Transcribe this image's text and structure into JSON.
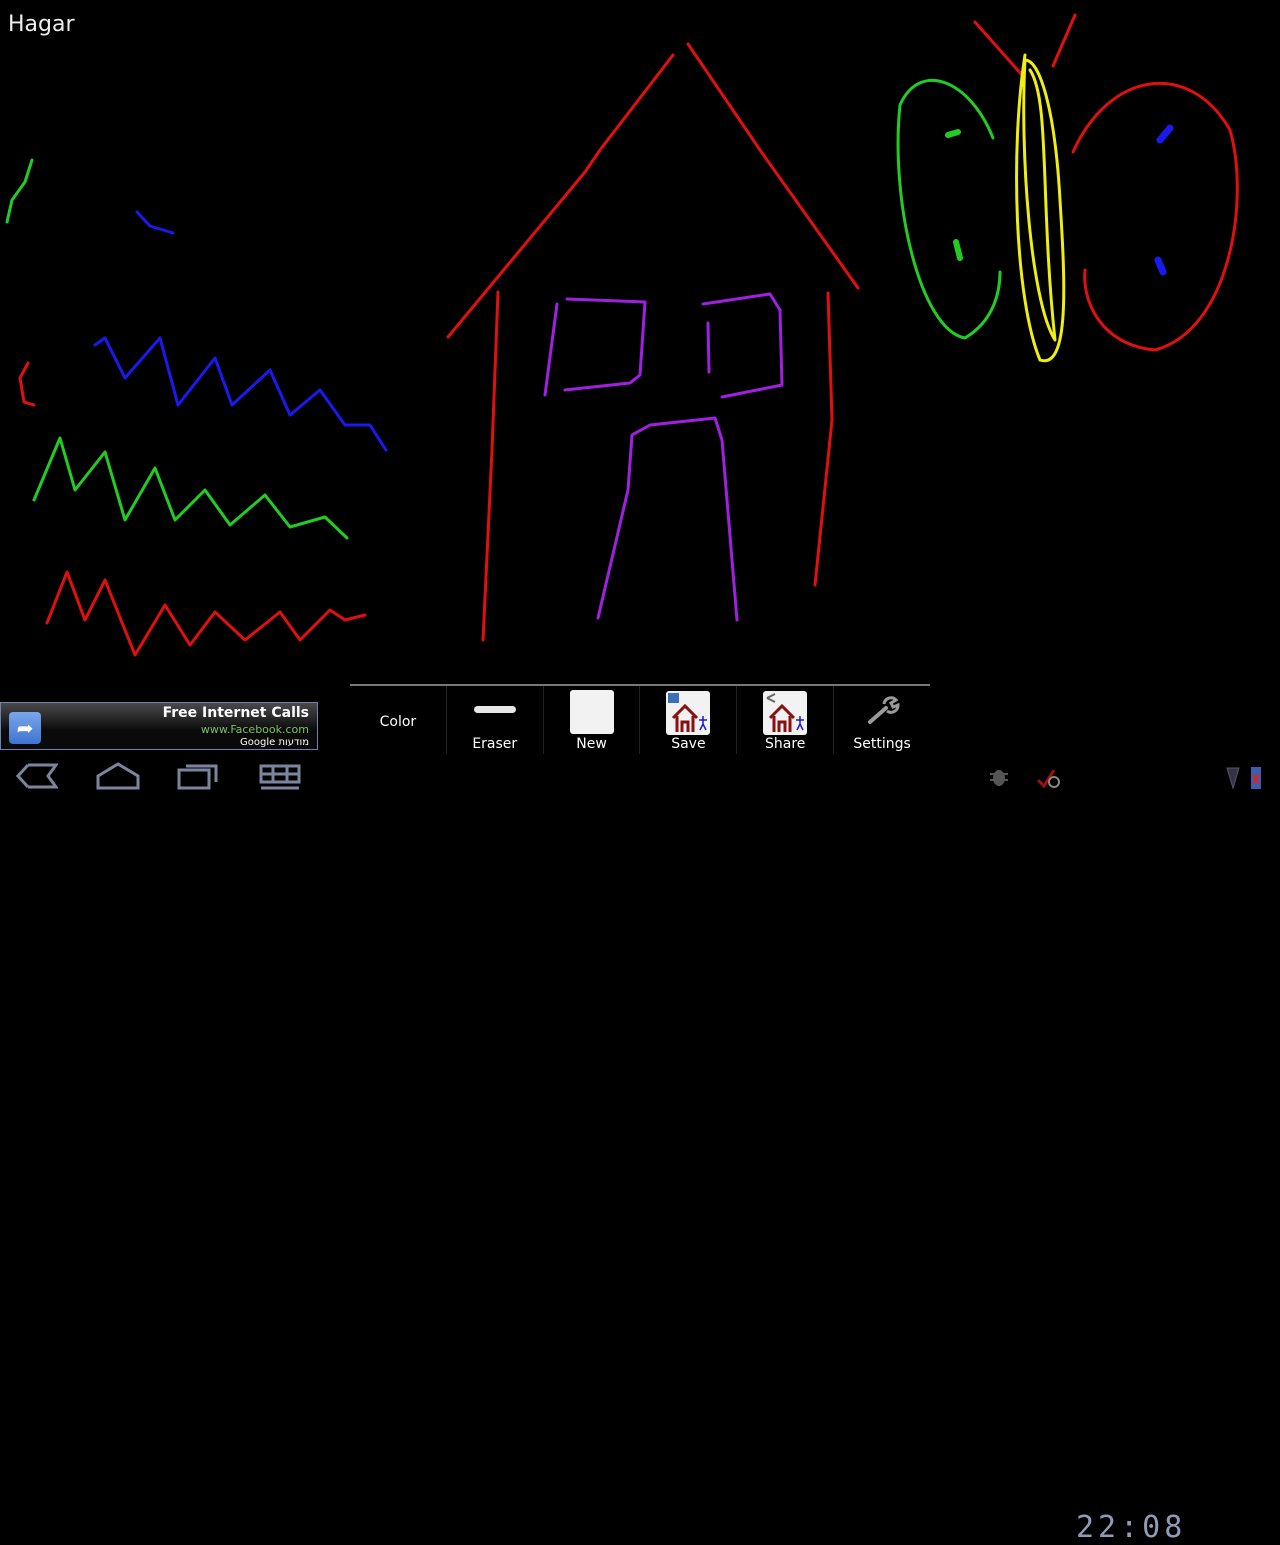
{
  "drawing": {
    "title": "Hagar"
  },
  "ad": {
    "headline": "Free Internet Calls",
    "url": "www.Facebook.com",
    "attribution": "Google מודעות",
    "icon": "share-arrow-icon",
    "url_color": "#7fc06c"
  },
  "toolbar": {
    "items": [
      {
        "label": "Color",
        "icon": "none"
      },
      {
        "label": "Eraser",
        "icon": "eraser-icon"
      },
      {
        "label": "New",
        "icon": "new-page-icon"
      },
      {
        "label": "Save",
        "icon": "save-drawing-icon"
      },
      {
        "label": "Share",
        "icon": "share-drawing-icon"
      },
      {
        "label": "Settings",
        "icon": "wrench-icon"
      }
    ]
  },
  "system_bar": {
    "buttons": [
      "back-icon",
      "home-icon",
      "recent-apps-icon",
      "all-apps-icon"
    ],
    "status_icons": [
      "debug-icon",
      "no-sd-icon",
      "signal-icon",
      "battery-icon"
    ],
    "time": "22:08"
  },
  "colors": {
    "red": "#e01010",
    "green": "#22cc22",
    "blue": "#1a1aee",
    "purple": "#a020e0",
    "yellow": "#eeee10"
  }
}
